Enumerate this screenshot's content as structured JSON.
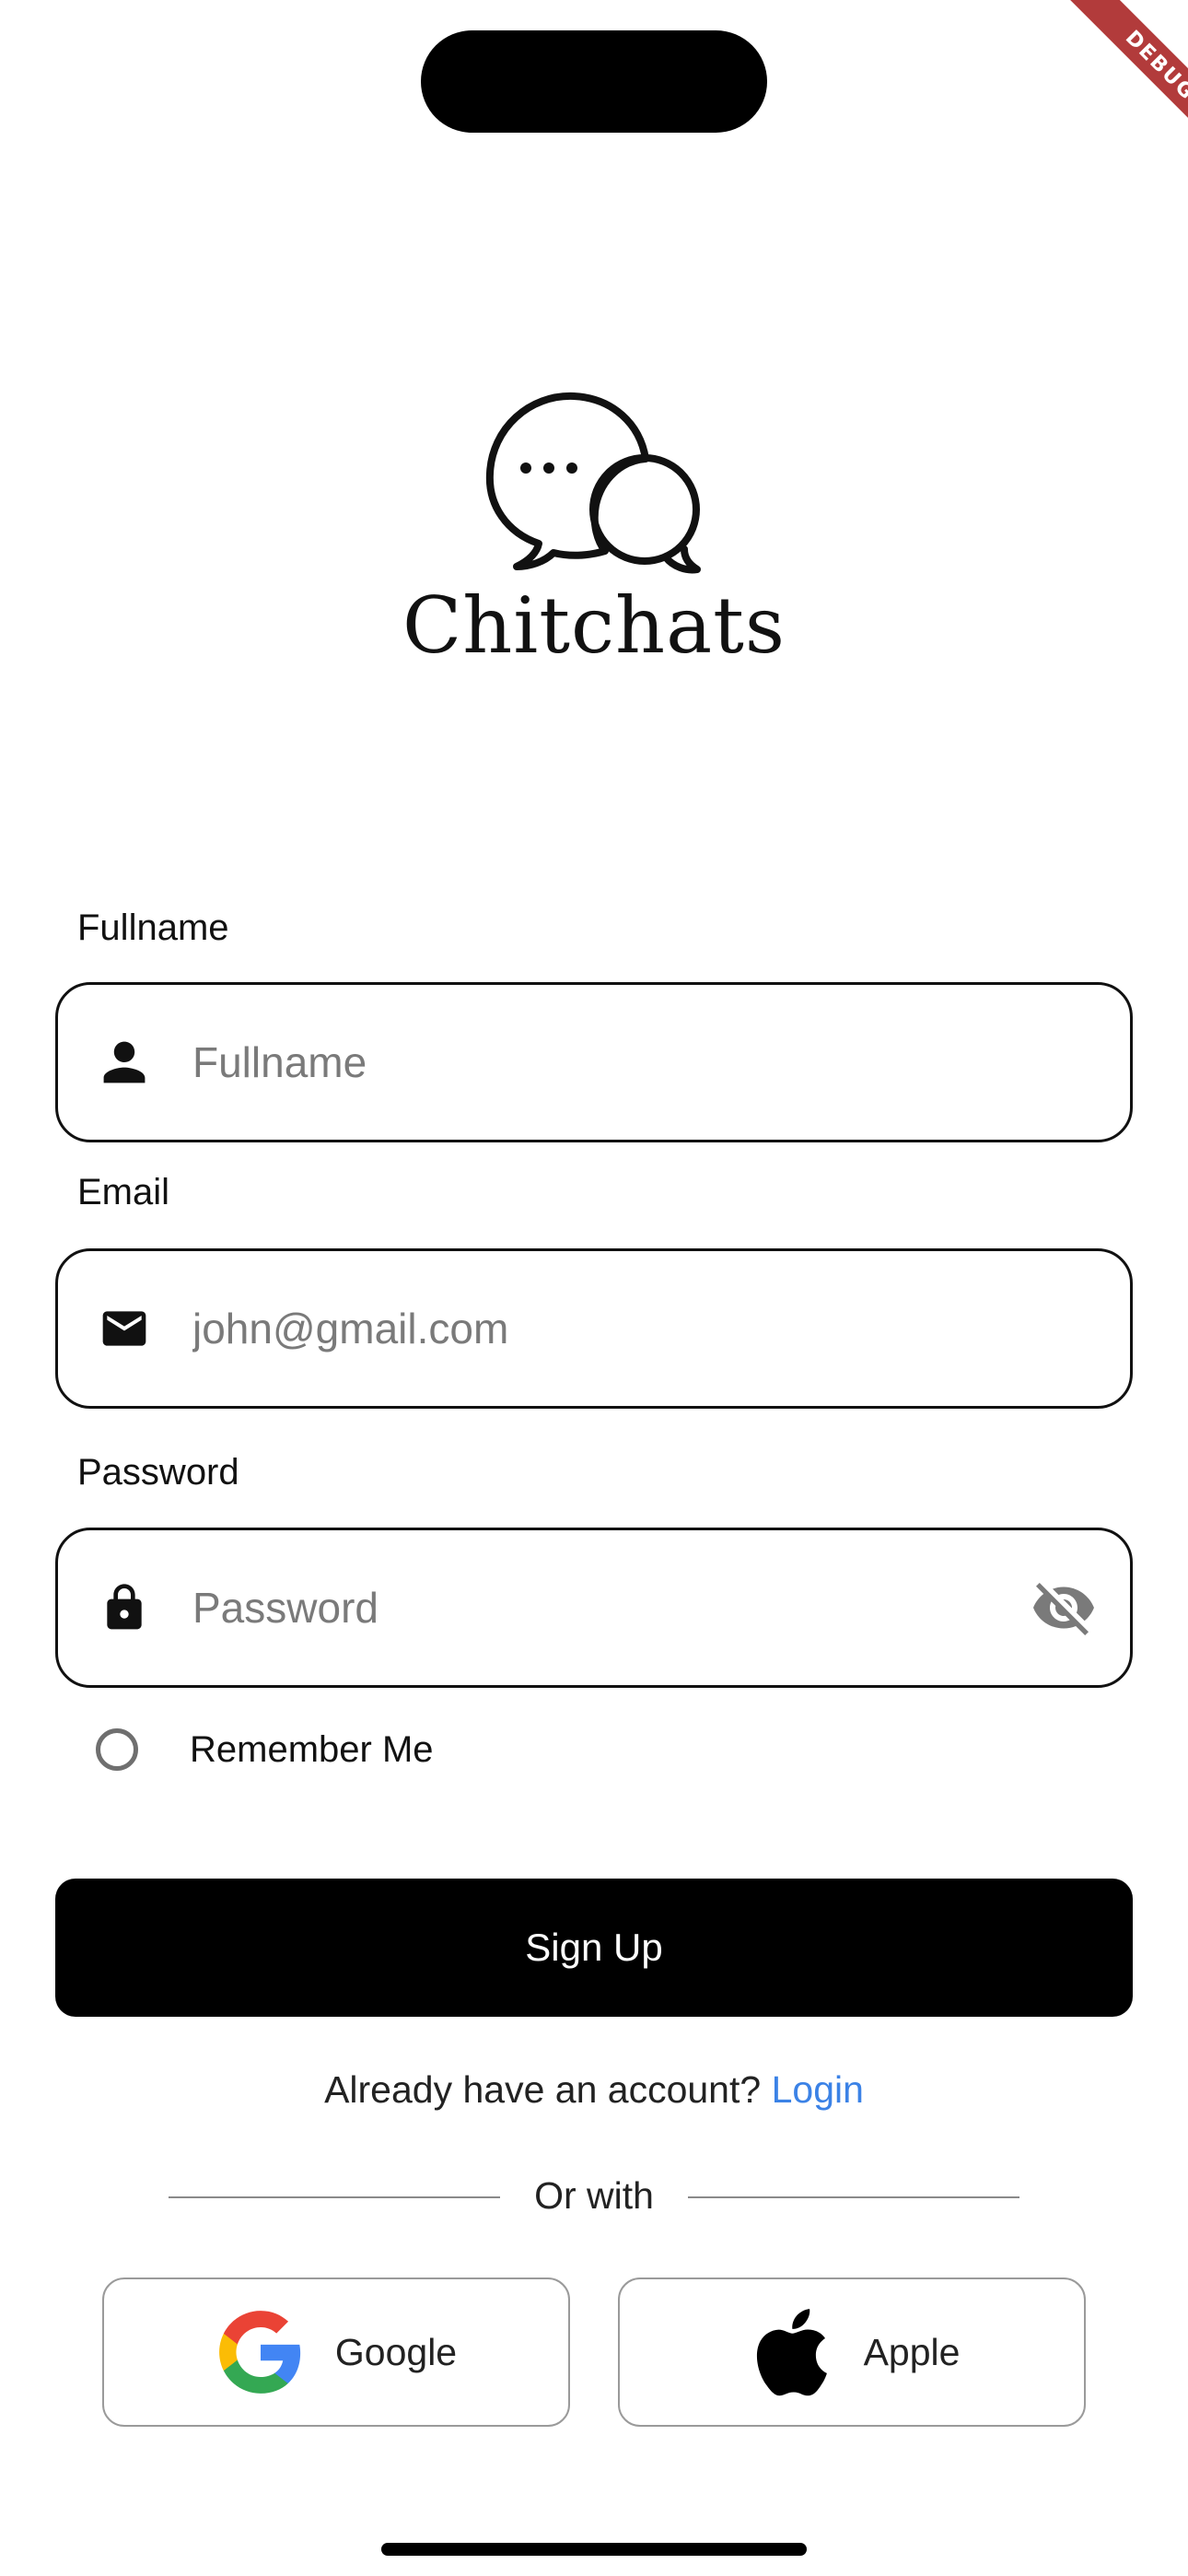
{
  "debug_banner": "DEBUG",
  "app": {
    "name": "Chitchats",
    "logo_icon": "chat-bubbles-icon"
  },
  "form": {
    "fullname": {
      "label": "Fullname",
      "placeholder": "Fullname",
      "value": "",
      "icon": "person-icon"
    },
    "email": {
      "label": "Email",
      "placeholder": "john@gmail.com",
      "value": "",
      "icon": "mail-icon"
    },
    "password": {
      "label": "Password",
      "placeholder": "Password",
      "value": "",
      "icon": "lock-icon",
      "toggle_icon": "eye-off-icon"
    },
    "remember_me": {
      "label": "Remember Me",
      "checked": false
    }
  },
  "actions": {
    "signup_label": "Sign Up",
    "have_account_text": "Already have an account?",
    "login_label": "Login",
    "or_with": "Or with"
  },
  "social": [
    {
      "label": "Google",
      "icon": "google-icon"
    },
    {
      "label": "Apple",
      "icon": "apple-icon"
    }
  ],
  "colors": {
    "primary": "#000000",
    "link": "#3b82e6",
    "border": "#111111",
    "placeholder": "#7a7a7a",
    "debug_ribbon": "#b23b3b"
  }
}
